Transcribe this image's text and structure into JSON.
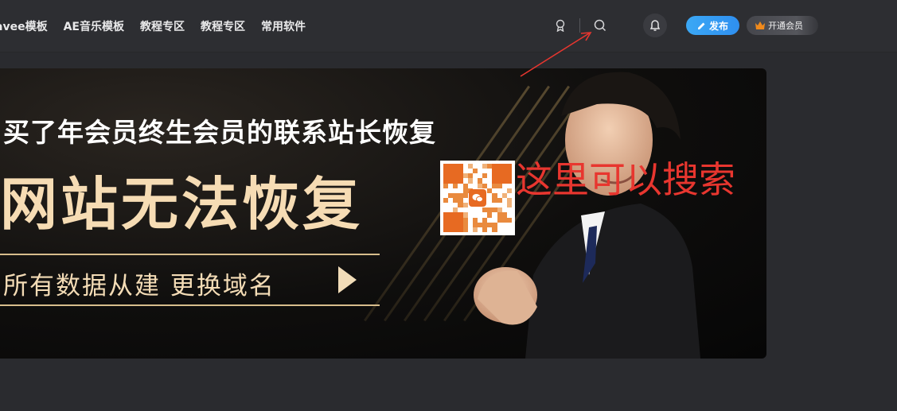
{
  "nav": {
    "items": [
      "avee模板",
      "AE音乐模板",
      "教程专区",
      "教程专区",
      "常用软件"
    ]
  },
  "header": {
    "icons": [
      "badge-icon",
      "search-icon",
      "bell-icon"
    ],
    "publish_label": "发布",
    "vip_label": "开通会员"
  },
  "banner": {
    "headline": "买了年会员终生会员的联系站长恢复",
    "title": "网站无法恢复",
    "subtitle": "所有数据从建 更换域名"
  },
  "annotation": {
    "text": "这里可以搜索",
    "color": "#e8362f"
  },
  "colors": {
    "accent_gold": "#f6dcb4",
    "publish_blue": "#2f8ff0",
    "qr_orange": "#e76a22"
  }
}
